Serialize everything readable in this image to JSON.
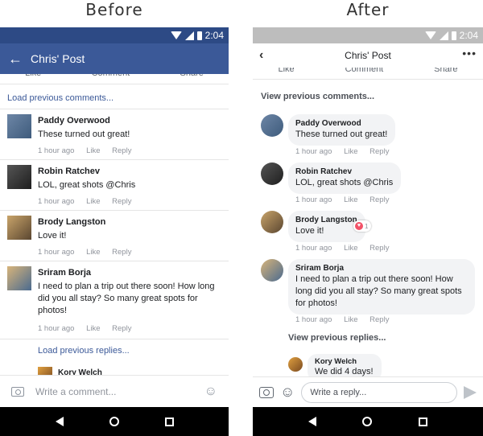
{
  "titles": {
    "before": "Before",
    "after": "After"
  },
  "status": {
    "time": "2:04"
  },
  "before": {
    "header_title": "Chris' Post",
    "actions": [
      "Like",
      "Comment",
      "Share"
    ],
    "load_previous": "Load previous comments...",
    "comments": [
      {
        "name": "Paddy Overwood",
        "text": "These turned out great!",
        "time": "1 hour ago",
        "like": "Like",
        "reply": "Reply"
      },
      {
        "name": "Robin Ratchev",
        "text": "LOL, great shots @Chris",
        "time": "1 hour ago",
        "like": "Like",
        "reply": "Reply"
      },
      {
        "name": "Brody Langston",
        "text": "Love it!",
        "time": "1 hour ago",
        "like": "Like",
        "reply": "Reply"
      },
      {
        "name": "Sriram Borja",
        "text": "I need to plan a trip out there soon! How long did you all stay? So many great spots for photos!",
        "time": "1 hour ago",
        "like": "Like",
        "reply": "Reply"
      }
    ],
    "load_replies": "Load previous replies...",
    "reply_name": "Kory Welch",
    "composer_placeholder": "Write a comment..."
  },
  "after": {
    "header_title": "Chris' Post",
    "more": "•••",
    "actions": [
      "Like",
      "Comment",
      "Share"
    ],
    "view_previous": "View previous comments...",
    "comments": [
      {
        "name": "Paddy Overwood",
        "text": "These turned out great!",
        "time": "1 hour ago",
        "like": "Like",
        "reply": "Reply"
      },
      {
        "name": "Robin Ratchev",
        "text": "LOL, great shots @Chris",
        "time": "1 hour ago",
        "like": "Like",
        "reply": "Reply"
      },
      {
        "name": "Brody Langston",
        "text": "Love it!",
        "time": "1 hour ago",
        "like": "Like",
        "reply": "Reply",
        "reaction_count": "1"
      },
      {
        "name": "Sriram Borja",
        "text": "I need to plan a trip out there soon! How long did you all stay? So many great spots for photos!",
        "time": "1 hour ago",
        "like": "Like",
        "reply": "Reply"
      }
    ],
    "view_replies": "View previous replies...",
    "reply": {
      "name": "Kory Welch",
      "text": "We did 4 days!"
    },
    "composer_placeholder": "Write a reply..."
  },
  "colors": {
    "brand": "#3b5998",
    "status_before": "#2d4a85",
    "heart": "#f25268",
    "bubble": "#f2f3f5"
  },
  "icons": [
    "back-arrow-icon",
    "more-icon",
    "camera-icon",
    "emoji-icon",
    "send-icon",
    "heart-icon"
  ]
}
